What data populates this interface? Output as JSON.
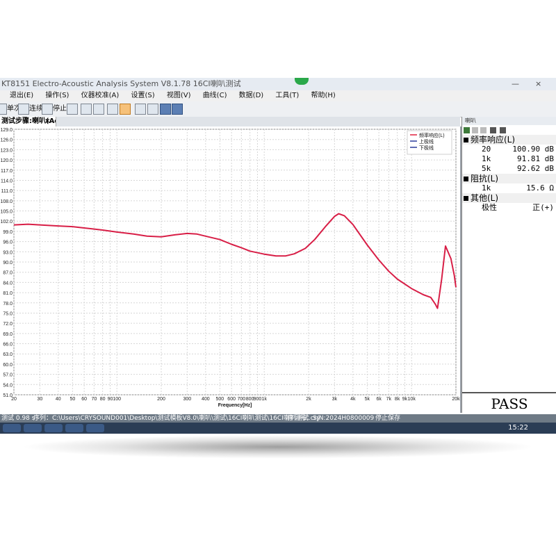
{
  "window": {
    "title": "KT8151 Electro-Acoustic Analysis System  V8.1.78 16CI喇叭测试",
    "min_label": "—",
    "close_label": "×"
  },
  "menu": [
    "退出(E)",
    "操作(S)",
    "仪器校准(A)",
    "设置(S)",
    "视图(V)",
    "曲线(C)",
    "数据(D)",
    "工具(T)",
    "帮助(H)"
  ],
  "toolbar": {
    "single_label": "单次",
    "continuous_label": "连续",
    "stop_label": "停止"
  },
  "tab": {
    "label": "测试步骤:喇叭(Active)",
    "close": "×"
  },
  "chart_data": {
    "type": "line",
    "xscale": "log",
    "xlabel": "Frequency[Hz]",
    "xlim": [
      20,
      20000
    ],
    "ylim": [
      51.0,
      129.0
    ],
    "yticks": [
      51.0,
      54.0,
      57.0,
      60.0,
      63.0,
      66.0,
      69.0,
      72.0,
      75.0,
      78.0,
      81.0,
      84.0,
      87.0,
      90.0,
      93.0,
      96.0,
      99.0,
      102.0,
      105.0,
      108.0,
      111.0,
      114.0,
      117.0,
      120.0,
      123.0,
      126.0,
      129.0
    ],
    "xticks": [
      {
        "v": 20,
        "l": "20"
      },
      {
        "v": 30,
        "l": "30"
      },
      {
        "v": 40,
        "l": "40"
      },
      {
        "v": 50,
        "l": "50"
      },
      {
        "v": 60,
        "l": "60"
      },
      {
        "v": 70,
        "l": "70"
      },
      {
        "v": 80,
        "l": "80"
      },
      {
        "v": 90,
        "l": "90"
      },
      {
        "v": 100,
        "l": "100"
      },
      {
        "v": 200,
        "l": "200"
      },
      {
        "v": 300,
        "l": "300"
      },
      {
        "v": 400,
        "l": "400"
      },
      {
        "v": 500,
        "l": "500"
      },
      {
        "v": 600,
        "l": "600"
      },
      {
        "v": 700,
        "l": "700"
      },
      {
        "v": 800,
        "l": "800"
      },
      {
        "v": 900,
        "l": "900"
      },
      {
        "v": 1000,
        "l": "1k"
      },
      {
        "v": 2000,
        "l": "2k"
      },
      {
        "v": 3000,
        "l": "3k"
      },
      {
        "v": 4000,
        "l": "4k"
      },
      {
        "v": 5000,
        "l": "5k"
      },
      {
        "v": 6000,
        "l": "6k"
      },
      {
        "v": 7000,
        "l": "7k"
      },
      {
        "v": 8000,
        "l": "8k"
      },
      {
        "v": 9000,
        "l": "9k"
      },
      {
        "v": 10000,
        "l": "10k"
      },
      {
        "v": 20000,
        "l": "20k"
      }
    ],
    "legend": [
      {
        "name": "频率响应(L)",
        "color": "#e0203e"
      },
      {
        "name": "上极线",
        "color": "#2a3a9a"
      },
      {
        "name": "下极线",
        "color": "#2a3a9a"
      }
    ],
    "legend_position": "top-right",
    "grid": true,
    "series": [
      {
        "name": "频率响应(L)",
        "color": "#d81e46",
        "points": [
          [
            20,
            100.9
          ],
          [
            25,
            101.1
          ],
          [
            30,
            100.9
          ],
          [
            40,
            100.6
          ],
          [
            50,
            100.4
          ],
          [
            60,
            100.0
          ],
          [
            80,
            99.4
          ],
          [
            100,
            98.8
          ],
          [
            130,
            98.2
          ],
          [
            160,
            97.6
          ],
          [
            200,
            97.4
          ],
          [
            250,
            98.0
          ],
          [
            300,
            98.4
          ],
          [
            350,
            98.2
          ],
          [
            400,
            97.6
          ],
          [
            500,
            96.6
          ],
          [
            600,
            95.2
          ],
          [
            700,
            94.2
          ],
          [
            800,
            93.2
          ],
          [
            1000,
            92.3
          ],
          [
            1200,
            91.8
          ],
          [
            1400,
            91.8
          ],
          [
            1600,
            92.4
          ],
          [
            1900,
            94.0
          ],
          [
            2200,
            96.6
          ],
          [
            2600,
            100.4
          ],
          [
            3000,
            103.4
          ],
          [
            3200,
            104.2
          ],
          [
            3500,
            103.6
          ],
          [
            4000,
            101.0
          ],
          [
            5000,
            95.0
          ],
          [
            6000,
            90.6
          ],
          [
            7000,
            87.3
          ],
          [
            8000,
            85.0
          ],
          [
            10000,
            82.2
          ],
          [
            12000,
            80.4
          ],
          [
            13500,
            79.6
          ],
          [
            14500,
            77.6
          ],
          [
            15000,
            76.4
          ],
          [
            16000,
            85.0
          ],
          [
            17000,
            94.7
          ],
          [
            18500,
            91.0
          ],
          [
            19500,
            86.0
          ],
          [
            20000,
            82.6
          ]
        ]
      }
    ]
  },
  "side_panel": {
    "title": "喇叭",
    "sections": [
      {
        "title": "频率响应(L)",
        "rows": [
          {
            "k": "20",
            "v": "100.90 dB"
          },
          {
            "k": "1k",
            "v": "91.81 dB"
          },
          {
            "k": "5k",
            "v": "92.62 dB"
          }
        ]
      },
      {
        "title": "阻抗(L)",
        "rows": [
          {
            "k": "1k",
            "v": "15.6 Ω"
          }
        ]
      },
      {
        "title": "其他(L)",
        "rows": [
          {
            "k": "极性",
            "v": "正(+)"
          }
        ]
      }
    ],
    "result": "PASS"
  },
  "statusbar": {
    "left": "测试  0.98 s",
    "path": "序列：C:\\Users\\CRYSOUND001\\Desktop\\测试模板V8.0\\喇叭\\测试\\16CI喇叭测试\\16CI喇叭测试.cry",
    "serial": "序列号：S/N:2024H0800009",
    "state": "停止保存"
  },
  "taskbar": {
    "clock": "15:22"
  }
}
